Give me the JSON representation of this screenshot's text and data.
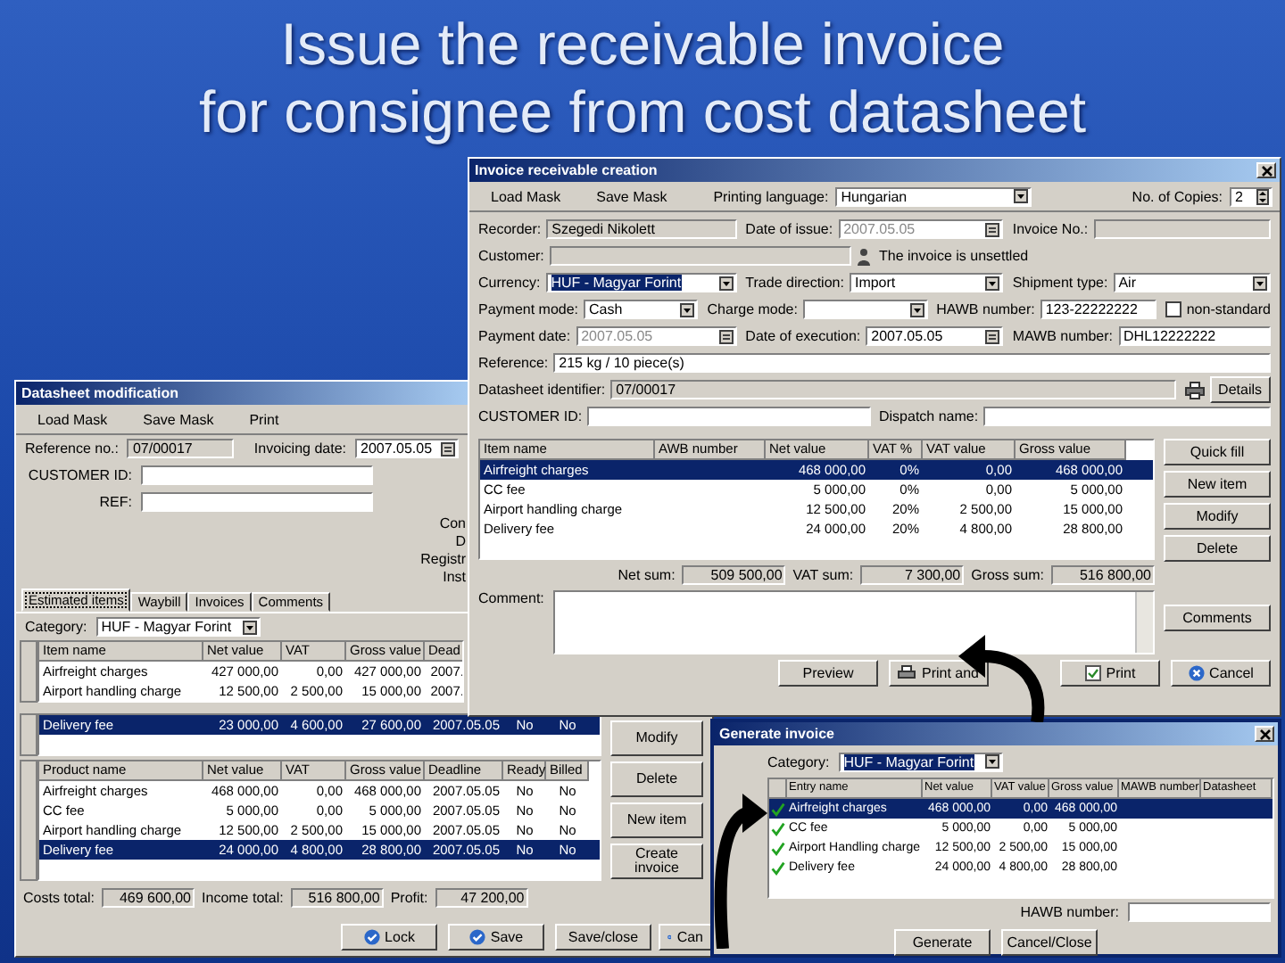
{
  "slide_title": [
    "Issue the receivable invoice",
    "for consignee from cost datasheet"
  ],
  "invoice_window": {
    "title": "Invoice receivable creation",
    "toolbar": [
      "Load Mask",
      "Save Mask"
    ],
    "printing_language": {
      "label": "Printing language:",
      "value": "Hungarian"
    },
    "copies": {
      "label": "No. of Copies:",
      "value": "2"
    },
    "form_rows": [
      [
        {
          "kind": "readonly",
          "label": "Recorder:",
          "value": "Szegedi Nikolett"
        },
        {
          "kind": "date",
          "label": "Date of issue:",
          "value": "2007.05.05",
          "disabled": true
        },
        {
          "kind": "readonly",
          "label": "Invoice No.:"
        }
      ],
      [
        {
          "kind": "lookup",
          "label": "Customer:"
        },
        {
          "kind": "note",
          "value": "The invoice is unsettled"
        }
      ],
      [
        {
          "kind": "select",
          "label": "Currency:",
          "value": "HUF - Magyar Forint",
          "focused": true
        },
        {
          "kind": "select",
          "label": "Trade direction:",
          "value": "Import",
          "focused": false
        },
        {
          "kind": "select",
          "label": "Shipment type:",
          "value": "Air",
          "focused": false
        }
      ],
      [
        {
          "kind": "select",
          "label": "Payment mode:",
          "value": "Cash",
          "focused": false
        },
        {
          "kind": "select",
          "label": "Charge mode:"
        },
        {
          "kind": "text",
          "label": "HAWB number:",
          "value": "123-22222222"
        },
        {
          "kind": "check",
          "label": "non-standard",
          "checked": false
        }
      ],
      [
        {
          "kind": "date",
          "label": "Payment date:",
          "value": "2007.05.05",
          "disabled": true
        },
        {
          "kind": "date",
          "label": "Date of execution:",
          "value": "2007.05.05",
          "disabled": false
        },
        {
          "kind": "text",
          "label": "MAWB number:",
          "value": "DHL12222222"
        }
      ],
      [
        {
          "kind": "text",
          "label": "Reference:",
          "value": "215 kg / 10 piece(s)"
        }
      ],
      [
        {
          "kind": "readonly",
          "label": "Datasheet identifier:",
          "value": "07/00017"
        },
        {
          "kind": "button",
          "label": "Details"
        }
      ],
      [
        {
          "kind": "text",
          "label": "CUSTOMER ID:"
        },
        {
          "kind": "text",
          "label": "Dispatch name:"
        }
      ]
    ],
    "table": {
      "columns": [
        "Item name",
        "AWB number",
        "Net value",
        "VAT %",
        "VAT value",
        "Gross value"
      ],
      "rows": [
        {
          "selected": true,
          "cells": [
            "Airfreight charges",
            null,
            "468 000,00",
            "0%",
            "0,00",
            "468 000,00"
          ]
        },
        {
          "selected": false,
          "cells": [
            "CC fee",
            null,
            "5 000,00",
            "0%",
            "0,00",
            "5 000,00"
          ]
        },
        {
          "selected": false,
          "cells": [
            "Airport handling charge",
            null,
            "12 500,00",
            "20%",
            "2 500,00",
            "15 000,00"
          ]
        },
        {
          "selected": false,
          "cells": [
            "Delivery fee",
            null,
            "24 000,00",
            "20%",
            "4 800,00",
            "28 800,00"
          ]
        }
      ]
    },
    "sums": [
      {
        "label": "Net sum:",
        "value": "509 500,00"
      },
      {
        "label": "VAT sum:",
        "value": "7 300,00"
      },
      {
        "label": "Gross sum:",
        "value": "516 800,00"
      }
    ],
    "side_buttons": [
      "Quick fill",
      "New item",
      "Modify",
      "Delete"
    ],
    "comment": {
      "label": "Comment:"
    },
    "comments_button": "Comments",
    "bottom_buttons": [
      {
        "label": "Preview",
        "kind": "plain"
      },
      {
        "label": "Print and",
        "kind": "printer"
      },
      {
        "label": "Print",
        "kind": "tick"
      },
      {
        "label": "Cancel",
        "kind": "cancel"
      }
    ]
  },
  "datasheet_window": {
    "title": "Datasheet modification",
    "toolbar": [
      "Load Mask",
      "Save Mask",
      "Print"
    ],
    "reference": {
      "label": "Reference no.:",
      "value": "07/00017"
    },
    "invoicing_date": {
      "label": "Invoicing date:",
      "value": "2007.05.05"
    },
    "fields": [
      {
        "label": "CUSTOMER ID:"
      },
      {
        "label": "REF:"
      }
    ],
    "cut_labels": [
      "Con",
      "D",
      "Registr",
      "Inst"
    ],
    "tabs": [
      {
        "label": "Estimated items",
        "selected": true
      },
      {
        "label": "Waybill",
        "selected": false
      },
      {
        "label": "Invoices",
        "selected": false
      },
      {
        "label": "Comments",
        "selected": false
      }
    ],
    "category": {
      "label": "Category:",
      "value": "HUF - Magyar Forint"
    },
    "costs_table": {
      "columns": [
        "Item name",
        "Net value",
        "VAT",
        "Gross value",
        "Dead"
      ],
      "rows": [
        {
          "selected": false,
          "cells": [
            "Airfreight charges",
            "427 000,00",
            "0,00",
            "427 000,00",
            "2007."
          ]
        },
        {
          "selected": false,
          "cells": [
            "Airport handling charge",
            "12 500,00",
            "2 500,00",
            "15 000,00",
            "2007."
          ]
        }
      ]
    },
    "costs_rows_below": [
      {
        "selected": true,
        "cells": [
          "Delivery fee",
          "23 000,00",
          "4 600,00",
          "27 600,00",
          "2007.05.05",
          "No",
          "No"
        ]
      }
    ],
    "income_table": {
      "columns": [
        "Product name",
        "Net value",
        "VAT",
        "Gross value",
        "Deadline",
        "Ready",
        "Billed"
      ],
      "rows": [
        {
          "selected": false,
          "cells": [
            "Airfreight charges",
            "468 000,00",
            "0,00",
            "468 000,00",
            "2007.05.05",
            "No",
            "No"
          ]
        },
        {
          "selected": false,
          "cells": [
            "CC fee",
            "5 000,00",
            "0,00",
            "5 000,00",
            "2007.05.05",
            "No",
            "No"
          ]
        },
        {
          "selected": false,
          "cells": [
            "Airport handling charge",
            "12 500,00",
            "2 500,00",
            "15 000,00",
            "2007.05.05",
            "No",
            "No"
          ]
        },
        {
          "selected": true,
          "cells": [
            "Delivery fee",
            "24 000,00",
            "4 800,00",
            "28 800,00",
            "2007.05.05",
            "No",
            "No"
          ]
        }
      ]
    },
    "totals": [
      {
        "label": "Costs total:",
        "value": "469 600,00"
      },
      {
        "label": "Income total:",
        "value": "516 800,00"
      },
      {
        "label": "Profit:",
        "value": "47 200,00"
      }
    ],
    "side_buttons": [
      "Modify",
      "Delete",
      "New item",
      "Create invoice"
    ],
    "bottom_buttons": [
      {
        "label": "Lock",
        "kind": "confirm"
      },
      {
        "label": "Save",
        "kind": "confirm"
      },
      {
        "label": "Save/close",
        "kind": "plain"
      },
      {
        "label": "Can",
        "kind": "cancel"
      }
    ]
  },
  "generate_window": {
    "title": "Generate invoice",
    "category": {
      "label": "Category:",
      "value": "HUF - Magyar Forint"
    },
    "table": {
      "columns": [
        "Entry name",
        "Net value",
        "VAT value",
        "Gross value",
        "MAWB number",
        "Datasheet"
      ],
      "rows": [
        {
          "selected": true,
          "checked": true,
          "cells": [
            "Airfreight charges",
            "468 000,00",
            "0,00",
            "468 000,00"
          ]
        },
        {
          "selected": false,
          "checked": true,
          "cells": [
            "CC fee",
            "5 000,00",
            "0,00",
            "5 000,00"
          ]
        },
        {
          "selected": false,
          "checked": true,
          "cells": [
            "Airport Handling charge",
            "12 500,00",
            "2 500,00",
            "15 000,00"
          ]
        },
        {
          "selected": false,
          "checked": true,
          "cells": [
            "Delivery fee",
            "24 000,00",
            "4 800,00",
            "28 800,00"
          ]
        }
      ]
    },
    "hawb": {
      "label": "HAWB number:"
    },
    "buttons": [
      "Generate",
      "Cancel/Close"
    ]
  }
}
